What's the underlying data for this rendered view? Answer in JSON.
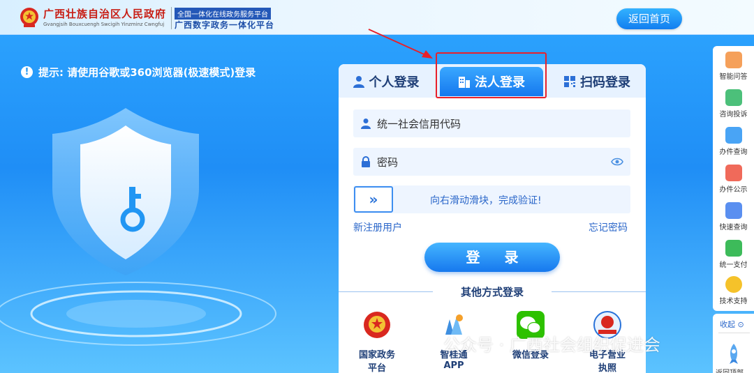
{
  "header": {
    "title": "广西壮族自治区人民政府",
    "subtitle": "Gvangjsih Bouxcuengh Swcigih Yinzminz Cwngfuj",
    "badge_top": "全国一体化在线政务服务平台",
    "badge_bottom": "广西数字政务一体化平台",
    "home_button": "返回首页"
  },
  "tip": {
    "icon": "!",
    "text": "提示: 请使用谷歌或360浏览器(极速模式)登录"
  },
  "tabs": [
    {
      "label": "个人登录",
      "icon": "person-icon"
    },
    {
      "label": "法人登录",
      "icon": "building-icon",
      "active": true
    },
    {
      "label": "扫码登录",
      "icon": "qr-icon"
    }
  ],
  "form": {
    "credit_code_placeholder": "统一社会信用代码",
    "password_placeholder": "密码",
    "slider_knob": "»",
    "slider_text": "向右滑动滑块，完成验证!",
    "register_link": "新注册用户",
    "forgot_link": "忘记密码",
    "login_button": "登 录"
  },
  "other_login": {
    "title": "其他方式登录",
    "options": [
      {
        "label_1": "国家政务",
        "label_2": "平台"
      },
      {
        "label_1": "智桂通",
        "label_2": "APP"
      },
      {
        "label_1": "微信登录",
        "label_2": ""
      },
      {
        "label_1": "电子营业",
        "label_2": "执照"
      }
    ]
  },
  "sidebar": {
    "items": [
      {
        "label": "智能问答",
        "color": "#f5a05a"
      },
      {
        "label": "咨询投诉",
        "color": "#4cc07a"
      },
      {
        "label": "办件查询",
        "color": "#49a4f5"
      },
      {
        "label": "办件公示",
        "color": "#f06a5a"
      },
      {
        "label": "快速查询",
        "color": "#5a8ff0"
      },
      {
        "label": "统一支付",
        "color": "#3dbb5a"
      },
      {
        "label": "技术支持",
        "color": "#f5c22a"
      }
    ],
    "collapse": "收起",
    "back_to_top": "返回顶部"
  },
  "watermark": "公众号 · 广西社会组织促进会",
  "colors": {
    "accent": "#1678ee",
    "highlight": "#e8202a",
    "title_red": "#c81e14"
  }
}
